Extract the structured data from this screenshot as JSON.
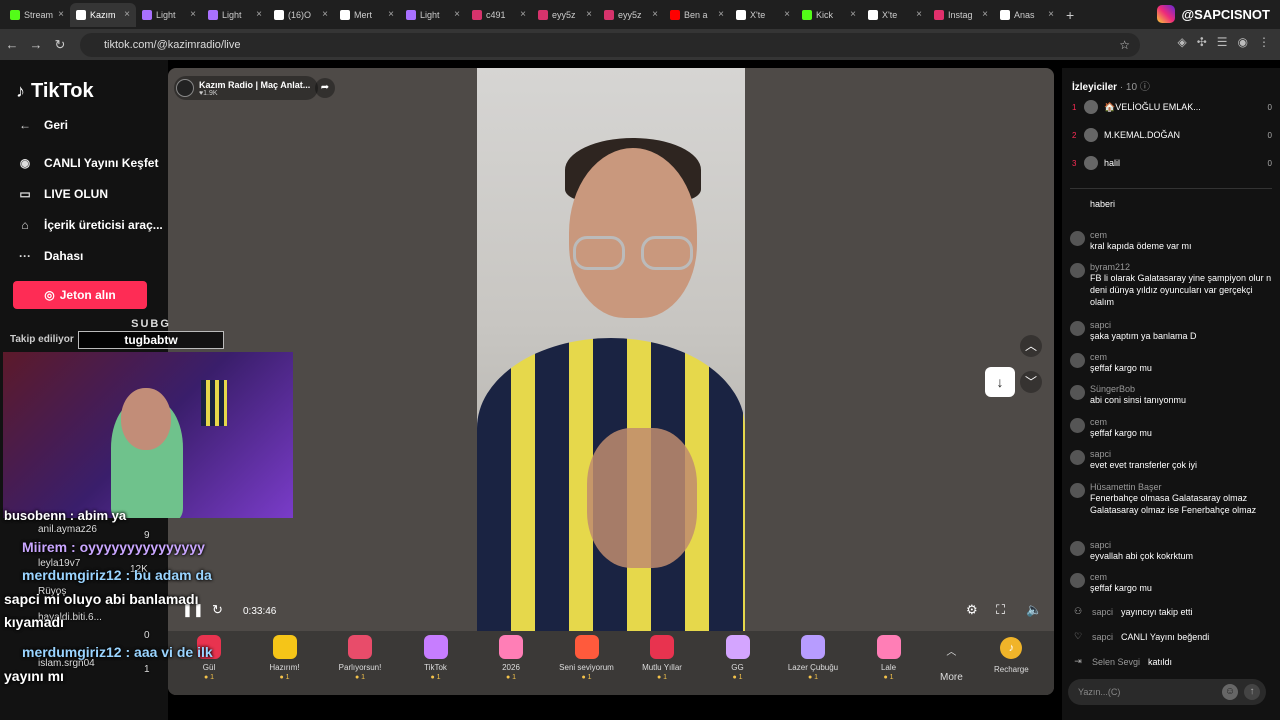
{
  "browser": {
    "tabs": [
      {
        "label": "Stream",
        "color": "#53fc18"
      },
      {
        "label": "Kazım",
        "color": "#ffffff",
        "active": true
      },
      {
        "label": "Light",
        "color": "#a970ff"
      },
      {
        "label": "Light",
        "color": "#a970ff"
      },
      {
        "label": "(16)O",
        "color": "#ffffff"
      },
      {
        "label": "Mert",
        "color": "#ffffff"
      },
      {
        "label": "Light",
        "color": "#a970ff"
      },
      {
        "label": "c491",
        "color": "#d6336c"
      },
      {
        "label": "eyy5z",
        "color": "#d6336c"
      },
      {
        "label": "eyy5z",
        "color": "#d6336c"
      },
      {
        "label": "Ben a",
        "color": "#ff0000"
      },
      {
        "label": "X'te",
        "color": "#ffffff"
      },
      {
        "label": "Kick",
        "color": "#53fc18"
      },
      {
        "label": "X'te",
        "color": "#ffffff"
      },
      {
        "label": "Instag",
        "color": "#e1306c"
      },
      {
        "label": "Anas",
        "color": "#ffffff"
      }
    ],
    "url": "tiktok.com/@kazimradio/live",
    "brand_handle": "@SAPCISNOT"
  },
  "sidebar": {
    "logo": "TikTok",
    "items": [
      {
        "label": "Geri",
        "icon": "back-arrow-icon"
      },
      {
        "label": "CANLI Yayını Keşfet",
        "icon": "live-avatar-icon"
      },
      {
        "label": "LIVE OLUN",
        "icon": "camera-icon"
      },
      {
        "label": "İçerik üreticisi araç...",
        "icon": "home-icon"
      },
      {
        "label": "Dahası",
        "icon": "more-icon"
      }
    ],
    "coins_button": "Jeton alın",
    "following_label": "Takip ediliyor"
  },
  "stream": {
    "channel_name": "Kazım Radio | Maç Anlat...",
    "channel_likes": "♥1.9K",
    "elapsed": "0:33:46",
    "colors": {
      "accent": "#fe2c55",
      "coin": "#f0b429"
    }
  },
  "gifts": [
    {
      "name": "Gül",
      "price": "1",
      "color": "#e8334f"
    },
    {
      "name": "Hazırım!",
      "price": "1",
      "color": "#f5c518"
    },
    {
      "name": "Parlıyorsun!",
      "price": "1",
      "color": "#e84c6a"
    },
    {
      "name": "TikTok",
      "price": "1",
      "color": "#c77dff"
    },
    {
      "name": "2026",
      "price": "1",
      "color": "#ff7eb6"
    },
    {
      "name": "Seni seviyorum",
      "price": "1",
      "color": "#ff5a3c"
    },
    {
      "name": "Mutlu Yıllar",
      "price": "1",
      "color": "#e8334f"
    },
    {
      "name": "GG",
      "price": "1",
      "color": "#d4a5ff"
    },
    {
      "name": "Lazer Çubuğu",
      "price": "1",
      "color": "#b79cff"
    },
    {
      "name": "Lale",
      "price": "1",
      "color": "#ff7eb6"
    }
  ],
  "gift_more": "More",
  "recharge": "Recharge",
  "webcam_overlay": {
    "sub_label": "SUBG",
    "sub_name": "tugbabtw",
    "lines": [
      {
        "user": "busobenn",
        "text": "busobenn : abim ya"
      },
      {
        "user": "Miirem",
        "text": "Miirem : oyyyyyyyyyyyyyyy"
      },
      {
        "user": "merdumgiriz12",
        "text": "merdumgiriz12 : bu adam da"
      },
      {
        "user": "",
        "text": "sapci mi oluyo abi banlamadı"
      },
      {
        "user": "",
        "text": "kıyamadı"
      },
      {
        "user": "merdumgiriz12",
        "text": "merdumgiriz12 : aaa vi de ilk"
      },
      {
        "user": "",
        "text": "yayını mı"
      }
    ],
    "small": [
      "anil.aymaz26",
      "leyla19v7",
      "Rüyoş",
      "hayaldi.biti.6...",
      "islam.srgn04"
    ],
    "counts": [
      "9",
      "12K",
      "0",
      "1"
    ]
  },
  "chat": {
    "viewers_label": "İzleyiciler",
    "viewers_count": "· 10",
    "top_viewers": [
      {
        "rank": "1",
        "name": "🏠VELİOĞLU EMLAK...",
        "score": "0"
      },
      {
        "rank": "2",
        "name": "M.KEMAL.DOĞAN",
        "score": "0"
      },
      {
        "rank": "3",
        "name": "halil",
        "score": "0"
      }
    ],
    "messages": [
      {
        "user": "",
        "text": "haberi"
      },
      {
        "user": "cem",
        "text": "kral kapıda ödeme var mı"
      },
      {
        "user": "byram212",
        "text": "FB li olarak Galatasaray yine şampiyon olur n deni dünya yıldız oyuncuları var gerçekçi olalım"
      },
      {
        "user": "sapci",
        "text": "şaka yaptım ya banlama D"
      },
      {
        "user": "cem",
        "text": "şeffaf kargo mu"
      },
      {
        "user": "SüngerBob",
        "text": "abi coni sinsi tanıyonmu"
      },
      {
        "user": "cem",
        "text": "şeffaf kargo mu"
      },
      {
        "user": "sapci",
        "text": "evet evet transferler çok iyi"
      },
      {
        "user": "Hüsamettin Başer",
        "text": "Fenerbahçe olmasa Galatasaray olmaz Galatasaray olmaz ise Fenerbahçe olmaz"
      },
      {
        "user": "sapci",
        "text": "eyvallah abi çok kokrktum"
      },
      {
        "user": "cem",
        "text": "şeffaf kargo mu"
      }
    ],
    "system": [
      {
        "user": "sapci",
        "text": "yayıncıyı takip etti",
        "icon": "follow-icon"
      },
      {
        "user": "sapci",
        "text": "CANLI Yayını beğendi",
        "icon": "heart-icon"
      },
      {
        "user": "Selen Sevgi",
        "text": "katıldı",
        "icon": "join-icon"
      }
    ],
    "input_placeholder": "Yazın...(C)"
  }
}
